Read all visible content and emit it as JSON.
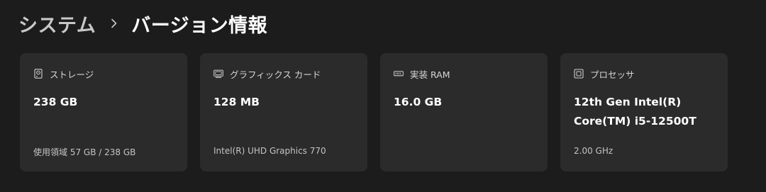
{
  "breadcrumb": {
    "parent": "システム",
    "current": "バージョン情報"
  },
  "cards": [
    {
      "icon": "storage-icon",
      "title": "ストレージ",
      "value": "238 GB",
      "sub": "使用領域 57 GB / 238 GB"
    },
    {
      "icon": "graphics-card-icon",
      "title": "グラフィックス カード",
      "value": "128 MB",
      "sub": "Intel(R) UHD Graphics 770"
    },
    {
      "icon": "ram-icon",
      "title": "実装 RAM",
      "value": "16.0 GB",
      "sub": ""
    },
    {
      "icon": "processor-icon",
      "title": "プロセッサ",
      "value_line1": "12th Gen Intel(R)",
      "value_line2": "Core(TM) i5-12500T",
      "sub": "2.00 GHz"
    }
  ]
}
